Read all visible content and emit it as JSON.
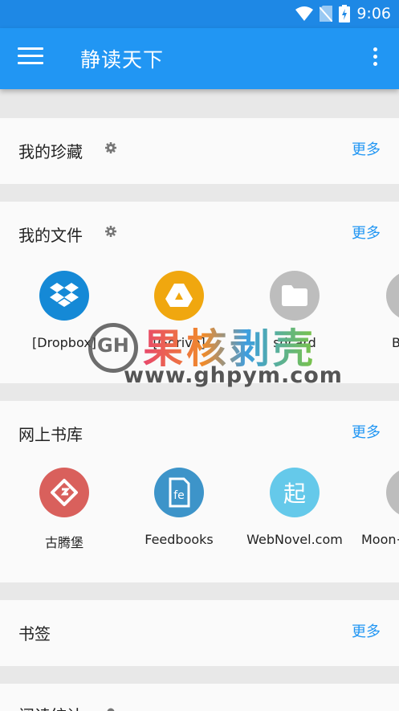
{
  "status": {
    "time": "9:06"
  },
  "app": {
    "title": "静读天下"
  },
  "sections": {
    "favorites": {
      "title": "我的珍藏",
      "more": "更多"
    },
    "files": {
      "title": "我的文件",
      "more": "更多",
      "items": [
        {
          "label": "[Dropbox]",
          "color": "#1589d6",
          "icon": "dropbox-icon"
        },
        {
          "label": "[Gdrive]",
          "color": "#f0a70f",
          "icon": "google-drive-icon"
        },
        {
          "label": "sdcard",
          "color": "#bdbdbd",
          "icon": "folder-icon"
        },
        {
          "label": "B",
          "color": "#bdbdbd",
          "icon": "folder-icon"
        }
      ]
    },
    "library": {
      "title": "网上书库",
      "more": "更多",
      "items": [
        {
          "label": "古腾堡",
          "color": "#d9605c",
          "icon": "gutenberg-icon"
        },
        {
          "label": "Feedbooks",
          "color": "#3d94c9",
          "icon": "feedbooks-icon"
        },
        {
          "label": "WebNovel.com",
          "color": "#65c9ea",
          "icon": "webnovel-icon",
          "glyph": "起"
        },
        {
          "label": "Moon+",
          "color": "#bdbdbd",
          "icon": "moon-plus-icon"
        }
      ]
    },
    "bookmarks": {
      "title": "书签",
      "more": "更多"
    },
    "stats": {
      "title": "阅读统计"
    }
  },
  "watermark": {
    "cn": "果核剥壳",
    "url": "www.ghpym.com",
    "logo": "GH"
  }
}
